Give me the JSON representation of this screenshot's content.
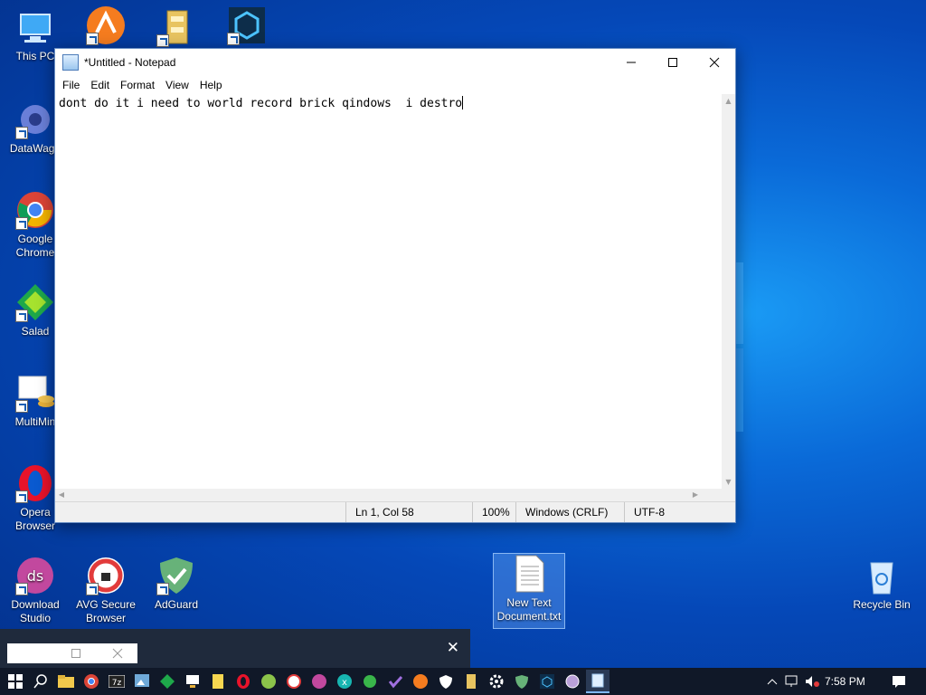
{
  "desktop": {
    "icons": [
      {
        "label": "This PC"
      },
      {
        "label": ""
      },
      {
        "label": ""
      },
      {
        "label": ""
      },
      {
        "label": "DataWago"
      },
      {
        "label": "Google Chrome"
      },
      {
        "label": "Salad"
      },
      {
        "label": "MultiMin"
      },
      {
        "label": "Opera Browser"
      },
      {
        "label": "Download Studio"
      },
      {
        "label": "AVG Secure Browser"
      },
      {
        "label": "AdGuard"
      },
      {
        "label": "New Text Document.txt"
      },
      {
        "label": "Recycle Bin"
      }
    ]
  },
  "notepad": {
    "title": "*Untitled - Notepad",
    "menu": [
      "File",
      "Edit",
      "Format",
      "View",
      "Help"
    ],
    "content": "dont do it i need to world record brick qindows  i destro",
    "status": {
      "position": "Ln 1, Col 58",
      "zoom": "100%",
      "line_ending": "Windows (CRLF)",
      "encoding": "UTF-8"
    }
  },
  "taskbar": {
    "time": "7:58 PM"
  },
  "colors": {
    "accent": "#0a6ad8",
    "taskbar": "#101828"
  }
}
